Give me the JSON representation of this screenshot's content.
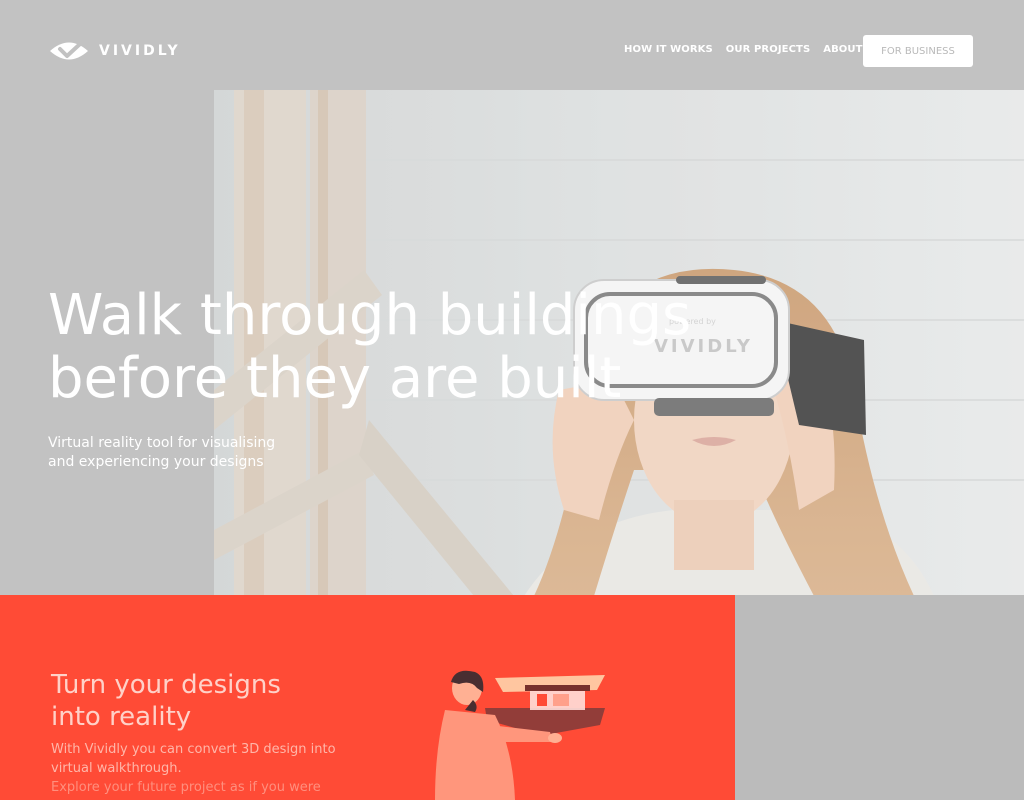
{
  "brand": {
    "name": "VIVIDLY",
    "icon": "vividly-eye-check-logo"
  },
  "nav": {
    "items": [
      {
        "label": "HOW IT WORKS"
      },
      {
        "label": "OUR PROJECTS"
      },
      {
        "label": "ABOUT US"
      }
    ],
    "cta_label": "FOR BUSINESS"
  },
  "hero": {
    "title_lines": [
      "Walk through buildings",
      "before they are built"
    ],
    "subtitle_lines": [
      "Virtual reality tool for visualising",
      "and experiencing your designs"
    ],
    "photo": {
      "headset_brand": "VIVIDLY",
      "headset_small": "powered by",
      "icon": "woman-vr-headset-photo"
    }
  },
  "feature": {
    "title_lines": [
      "Turn your designs",
      "into reality"
    ],
    "text_lines": [
      "With Vividly you can convert 3D design into",
      "virtual walkthrough.",
      "Explore your future project as if you were"
    ],
    "illustration_icon": "man-viewing-house-illustration"
  },
  "colors": {
    "page_bg": "#c2c2c2",
    "accent": "#ff4b36",
    "header_text": "#ffffff",
    "cta_text": "#b9b9b9"
  }
}
